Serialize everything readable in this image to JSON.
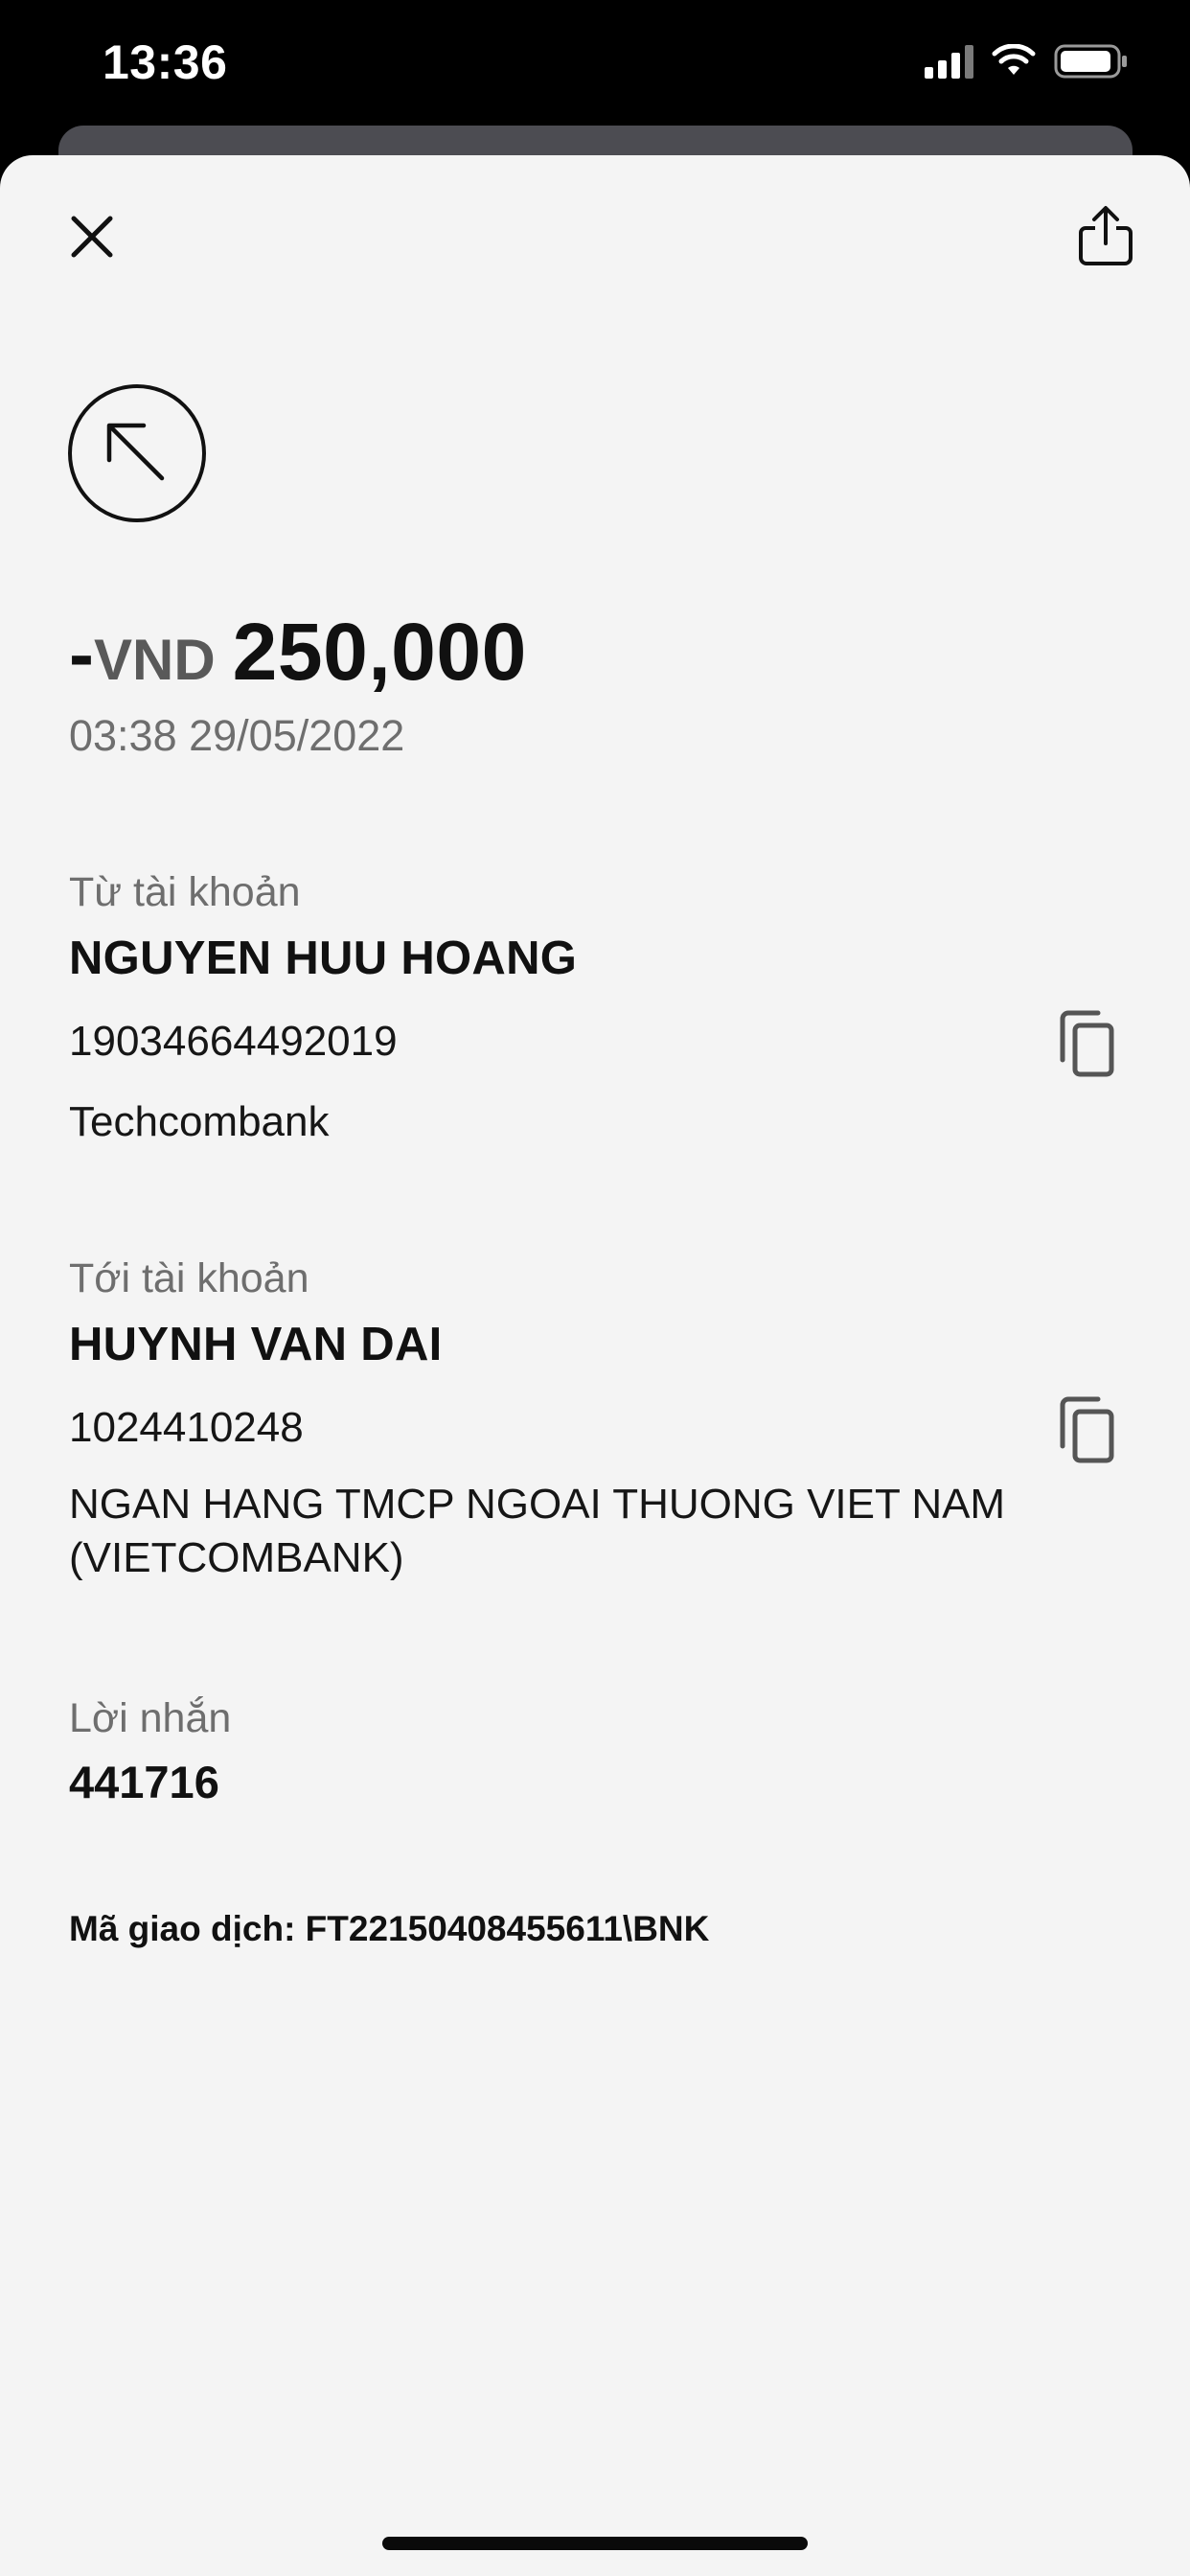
{
  "status_bar": {
    "time": "13:36"
  },
  "toolbar": {
    "close_icon": "close-icon",
    "share_icon": "share-icon"
  },
  "transaction": {
    "direction_icon": "arrow-up-left-icon",
    "sign": "-",
    "currency": "VND",
    "amount": "250,000",
    "datetime": "03:38 29/05/2022"
  },
  "from_account": {
    "label": "Từ tài khoản",
    "name": "NGUYEN HUU HOANG",
    "number": "19034664492019",
    "bank": "Techcombank",
    "copy_icon": "copy-icon"
  },
  "to_account": {
    "label": "Tới tài khoản",
    "name": "HUYNH VAN DAI",
    "number": "1024410248",
    "bank": "NGAN HANG TMCP NGOAI THUONG VIET NAM (VIETCOMBANK)",
    "copy_icon": "copy-icon"
  },
  "message": {
    "label": "Lời nhắn",
    "value": "441716"
  },
  "transaction_code": {
    "text": "Mã giao dịch: FT22150408455611\\BNK"
  },
  "colors": {
    "sheet_background": "#f4f4f4",
    "primary_text": "#111111",
    "secondary_text": "#6e6e6e",
    "status_bar_background": "#000000"
  }
}
